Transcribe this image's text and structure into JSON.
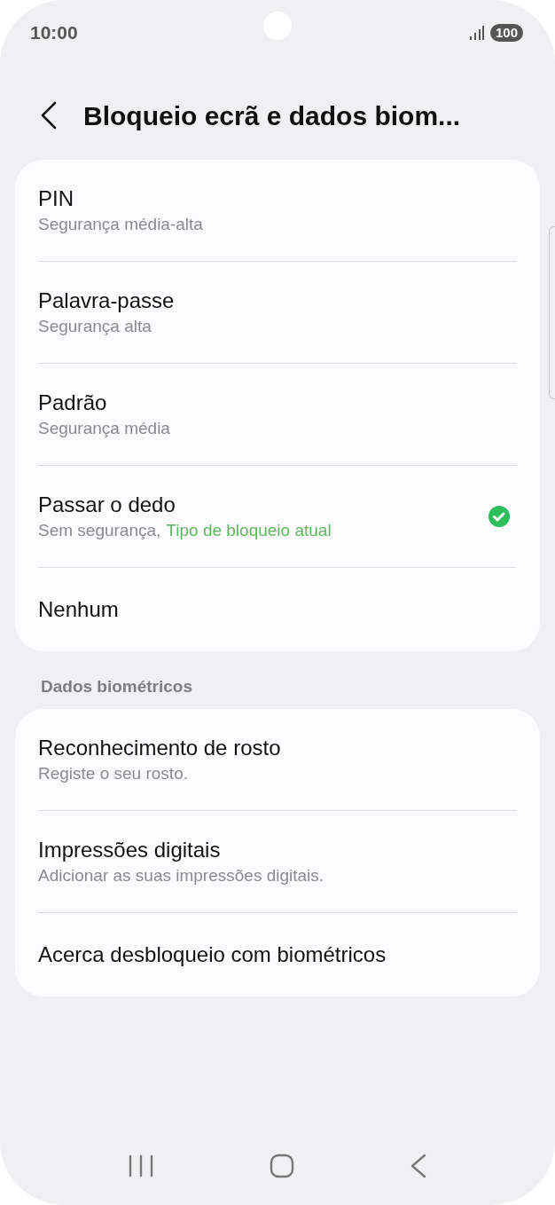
{
  "status_bar": {
    "time": "10:00",
    "battery": "100"
  },
  "header": {
    "title": "Bloqueio ecrã e dados biom..."
  },
  "lock_types": [
    {
      "title": "PIN",
      "subtitle": "Segurança média-alta",
      "selected": false
    },
    {
      "title": "Palavra-passe",
      "subtitle": "Segurança alta",
      "selected": false
    },
    {
      "title": "Padrão",
      "subtitle": "Segurança média",
      "selected": false
    },
    {
      "title": "Passar o dedo",
      "subtitle": "Sem segurança,",
      "note": "Tipo de bloqueio atual",
      "selected": true
    },
    {
      "title": "Nenhum",
      "selected": false
    }
  ],
  "biometrics": {
    "heading": "Dados biométricos",
    "items": [
      {
        "title": "Reconhecimento de rosto",
        "subtitle": "Registe o seu rosto."
      },
      {
        "title": "Impressões digitais",
        "subtitle": "Adicionar as suas impressões digitais."
      },
      {
        "title": "Acerca desbloqueio com biométricos"
      }
    ]
  }
}
